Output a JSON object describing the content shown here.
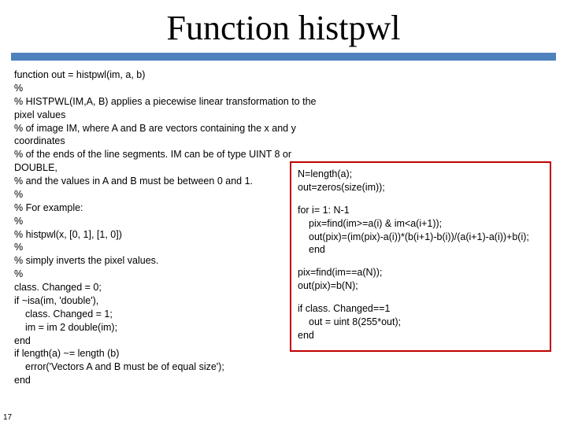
{
  "title": "Function histpwl",
  "page_number": "17",
  "left": {
    "l01": "function out = histpwl(im, a, b)",
    "l02": "%",
    "l03": "% HISTPWL(IM,A, B) applies a piecewise linear transformation to the pixel values",
    "l04": "% of image IM, where A and B are vectors containing the x and y coordinates",
    "l05": "% of the ends of the line segments. IM can be of type UINT 8 or DOUBLE,",
    "l06": "% and the values in A and B must be between 0 and 1.",
    "l07": "%",
    "l08": "% For example:",
    "l09": "%",
    "l10": "%   histpwl(x, [0, 1], [1, 0])",
    "l11": "%",
    "l12": "% simply inverts the pixel values.",
    "l13": "%",
    "l14": "class. Changed = 0;",
    "l15": "if ~isa(im, 'double'),",
    "l16": "class. Changed = 1;",
    "l17": "im = im 2 double(im);",
    "l18": "end",
    "l19_blank": " ",
    "l20": "if  length(a) ~= length (b)",
    "l21": "error('Vectors A and B must be of equal size');",
    "l22": "end"
  },
  "right": {
    "r01": "N=length(a);",
    "r02": "out=zeros(size(im));",
    "r03": "for i= 1: N-1",
    "r04": "pix=find(im>=a(i) & im<a(i+1));",
    "r05": "out(pix)=(im(pix)-a(i))*(b(i+1)-b(i))/(a(i+1)-a(i))+b(i);",
    "r06": "end",
    "r07": "pix=find(im==a(N));",
    "r08": "out(pix)=b(N);",
    "r09": "if class. Changed==1",
    "r10": "out = uint 8(255*out);",
    "r11": "end"
  }
}
